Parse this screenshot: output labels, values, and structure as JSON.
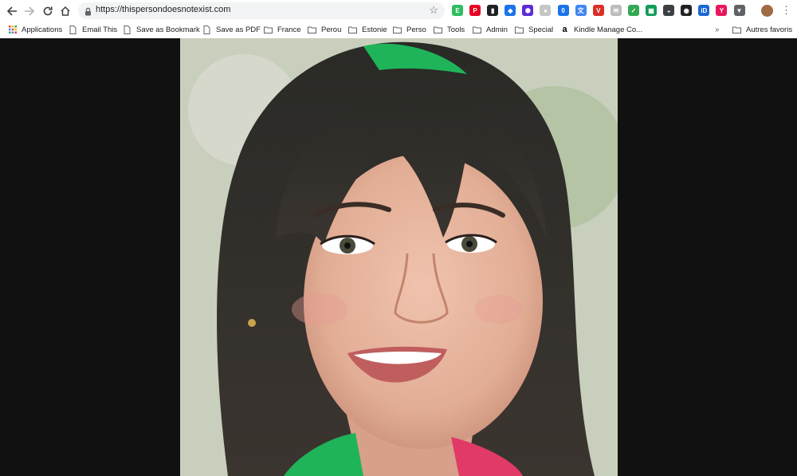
{
  "browser": {
    "url": "https://thispersondoesnotexist.com",
    "nav": {
      "back_icon": "arrow-left-icon",
      "forward_icon": "arrow-right-icon",
      "reload_icon": "reload-icon",
      "home_icon": "home-icon"
    },
    "bookmarks": [
      {
        "label": "Applications",
        "icon": "apps-grid-icon"
      },
      {
        "label": "Email This",
        "icon": "page-icon"
      },
      {
        "label": "Save as Bookmark",
        "icon": "page-icon"
      },
      {
        "label": "Save as PDF",
        "icon": "page-icon"
      },
      {
        "label": "France",
        "icon": "folder-icon"
      },
      {
        "label": "Perou",
        "icon": "folder-icon"
      },
      {
        "label": "Estonie",
        "icon": "folder-icon"
      },
      {
        "label": "Perso",
        "icon": "folder-icon"
      },
      {
        "label": "Tools",
        "icon": "folder-icon"
      },
      {
        "label": "Admin",
        "icon": "folder-icon"
      },
      {
        "label": "Special",
        "icon": "folder-icon"
      },
      {
        "label": "Kindle Manage Co...",
        "icon": "amazon-icon"
      }
    ],
    "overflow_label": "»",
    "other_bookmarks": "Autres favoris",
    "extensions": [
      {
        "name": "evernote-icon",
        "color": "#2dbe60",
        "glyph": "E"
      },
      {
        "name": "pinterest-icon",
        "color": "#e60023",
        "glyph": "P"
      },
      {
        "name": "bookmark-icon",
        "color": "#202124",
        "glyph": "▮"
      },
      {
        "name": "diamond-icon",
        "color": "#1a73e8",
        "glyph": "◆"
      },
      {
        "name": "hex-icon",
        "color": "#5b2bd6",
        "glyph": "⬢"
      },
      {
        "name": "grey-circle-icon",
        "color": "#c5c5c5",
        "glyph": "●"
      },
      {
        "name": "calendar-icon",
        "color": "#1a73e8",
        "glyph": "0"
      },
      {
        "name": "translate-icon",
        "color": "#4285f4",
        "glyph": "文"
      },
      {
        "name": "vivaldi-icon",
        "color": "#d93025",
        "glyph": "V"
      },
      {
        "name": "chat-icon",
        "color": "#bdbdbd",
        "glyph": "✉"
      },
      {
        "name": "check-icon",
        "color": "#34a853",
        "glyph": "✓"
      },
      {
        "name": "sheet-icon",
        "color": "#0f9d58",
        "glyph": "▦"
      },
      {
        "name": "pocket-icon",
        "color": "#3c4043",
        "glyph": "◒"
      },
      {
        "name": "camera-icon",
        "color": "#202124",
        "glyph": "◉"
      },
      {
        "name": "id-icon",
        "color": "#1967d2",
        "glyph": "iD"
      },
      {
        "name": "y-icon",
        "color": "#e8175d",
        "glyph": "Y"
      },
      {
        "name": "shield-icon",
        "color": "#5f6368",
        "glyph": "▼"
      }
    ]
  }
}
